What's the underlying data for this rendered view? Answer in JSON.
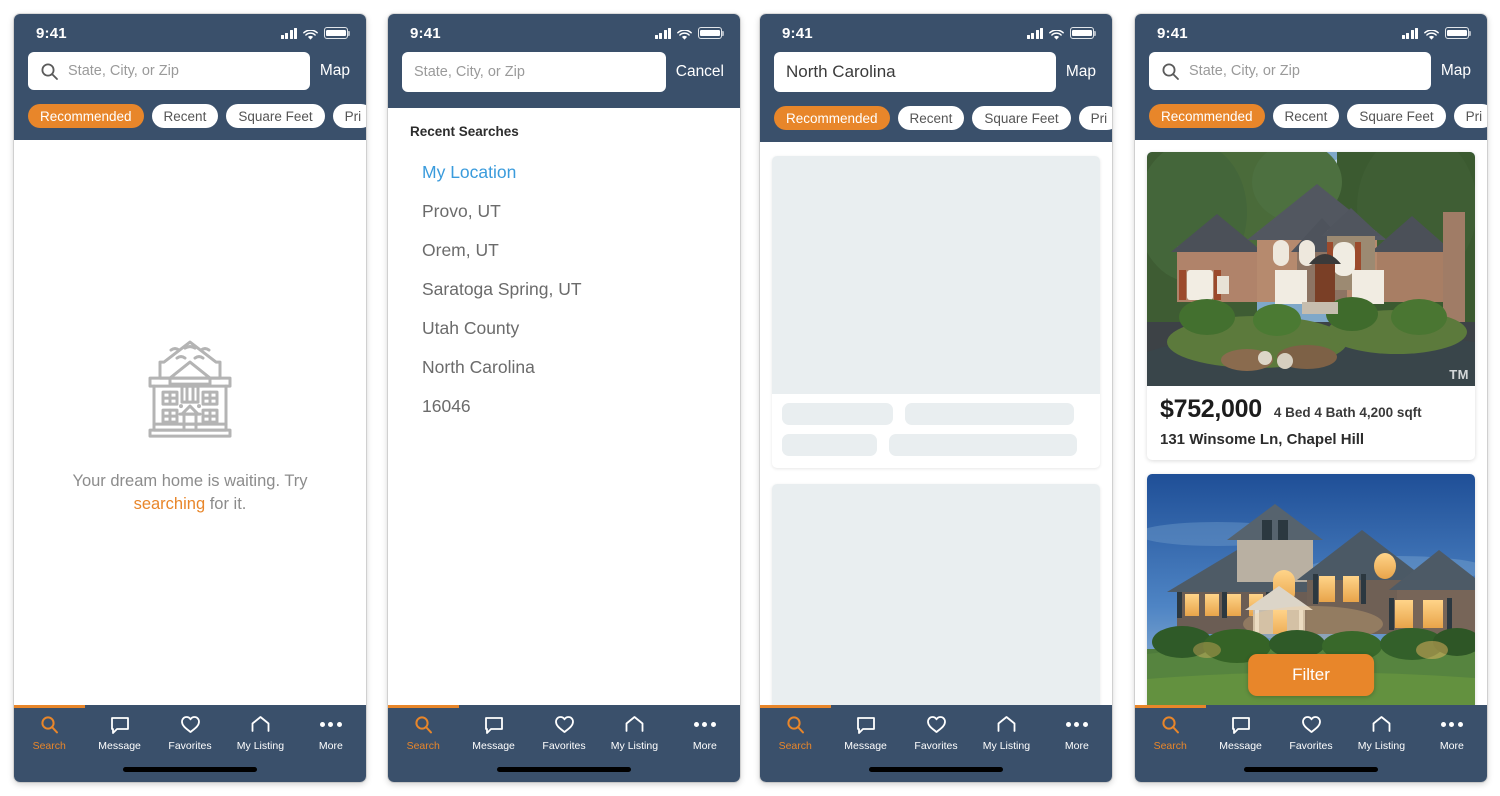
{
  "theme": {
    "navy": "#3a506b",
    "orange": "#e8862a",
    "link_blue": "#3a9bdc",
    "skeleton_gray": "#e9eef0",
    "muted_text": "#8c8c8c"
  },
  "status_bar": {
    "time": "9:41",
    "icons": [
      "cellular-signal-icon",
      "wifi-icon",
      "battery-icon"
    ]
  },
  "tab_bar": {
    "active_index": 0,
    "items": [
      {
        "label": "Search",
        "icon": "search-icon"
      },
      {
        "label": "Message",
        "icon": "message-icon"
      },
      {
        "label": "Favorites",
        "icon": "heart-icon"
      },
      {
        "label": "My Listing",
        "icon": "house-icon"
      },
      {
        "label": "More",
        "icon": "ellipsis-icon"
      }
    ]
  },
  "filter_chips": [
    {
      "label": "Recommended",
      "active": true
    },
    {
      "label": "Recent",
      "active": false
    },
    {
      "label": "Square Feet",
      "active": false
    },
    {
      "label": "Pri",
      "active": false
    }
  ],
  "screens": [
    {
      "id": "empty-search",
      "search": {
        "placeholder": "State, City, or Zip",
        "value": "",
        "icon": "search-icon",
        "action_label": "Map"
      },
      "empty_state": {
        "illustration": "house-outline-icon",
        "line1": "Your dream home is waiting. Try",
        "highlight": "searching",
        "line2": " for it."
      }
    },
    {
      "id": "recent-searches",
      "search": {
        "placeholder": "State, City, or Zip",
        "value": "",
        "icon": "none",
        "action_label": "Cancel"
      },
      "recent": {
        "title": "Recent Searches",
        "items": [
          {
            "label": "My Location",
            "is_location": true
          },
          {
            "label": "Provo, UT",
            "is_location": false
          },
          {
            "label": "Orem, UT",
            "is_location": false
          },
          {
            "label": "Saratoga Spring, UT",
            "is_location": false
          },
          {
            "label": "Utah County",
            "is_location": false
          },
          {
            "label": "North Carolina",
            "is_location": false
          },
          {
            "label": "16046",
            "is_location": false
          }
        ]
      }
    },
    {
      "id": "loading-results",
      "search": {
        "placeholder": "State, City, or Zip",
        "value": "North Carolina",
        "icon": "none",
        "action_label": "Map"
      },
      "skeleton_cards": 2
    },
    {
      "id": "results",
      "search": {
        "placeholder": "State, City, or Zip",
        "value": "",
        "icon": "search-icon",
        "action_label": "Map"
      },
      "filter_button_label": "Filter",
      "listings": [
        {
          "price": "$752,000",
          "specs": "4 Bed 4 Bath 4,200 sqft",
          "address": "131 Winsome Ln, Chapel Hill",
          "photo": "brick-stone-house-daytime",
          "watermark": "TM"
        },
        {
          "price": "",
          "specs": "",
          "address": "",
          "photo": "craftsman-house-dusk",
          "watermark": ""
        }
      ]
    }
  ]
}
